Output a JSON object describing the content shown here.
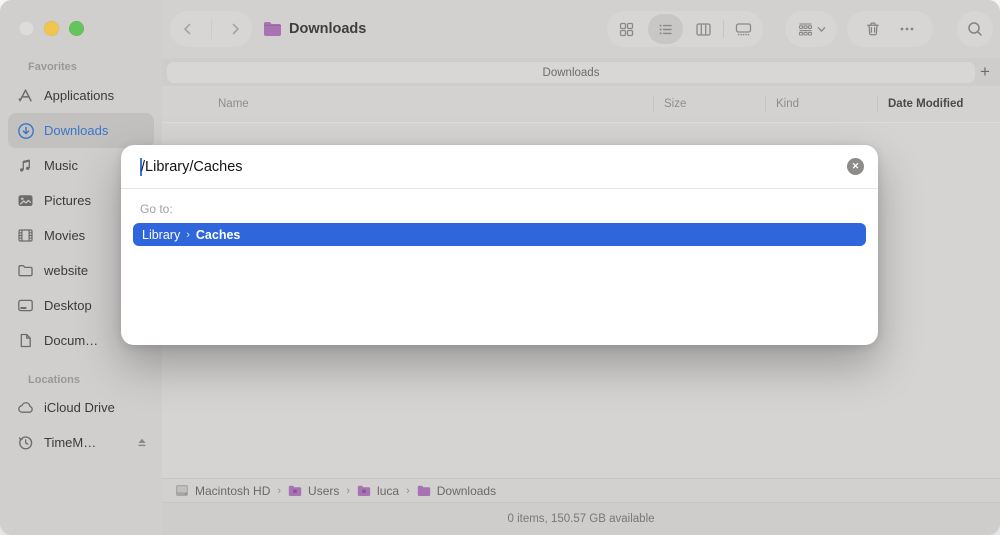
{
  "window": {
    "traffic_lights": [
      {
        "name": "close",
        "state": "disabled"
      },
      {
        "name": "minimize",
        "color": "#f0c64f"
      },
      {
        "name": "zoom",
        "color": "#65c45b"
      }
    ]
  },
  "toolbar": {
    "title": "Downloads",
    "title_icon": "folder-icon",
    "back_icon": "chevron-left-icon",
    "forward_icon": "chevron-right-icon",
    "view_modes": [
      {
        "name": "icon-view",
        "selected": false
      },
      {
        "name": "list-view",
        "selected": true
      },
      {
        "name": "column-view",
        "selected": false
      },
      {
        "name": "gallery-view",
        "selected": false
      }
    ],
    "group_button_icon": "group-by-icon",
    "trash_icon": "trash-icon",
    "more_icon": "ellipsis-icon",
    "search_icon": "search-icon"
  },
  "sidebar": {
    "sections": [
      {
        "title": "Favorites",
        "items": [
          {
            "label": "Applications",
            "icon": "applications-icon",
            "selected": false
          },
          {
            "label": "Downloads",
            "icon": "downloads-icon",
            "selected": true
          },
          {
            "label": "Music",
            "icon": "music-icon",
            "selected": false
          },
          {
            "label": "Pictures",
            "icon": "pictures-icon",
            "selected": false
          },
          {
            "label": "Movies",
            "icon": "movies-icon",
            "selected": false
          },
          {
            "label": "website",
            "icon": "folder-icon",
            "selected": false
          },
          {
            "label": "Desktop",
            "icon": "desktop-icon",
            "selected": false
          },
          {
            "label": "Docum…",
            "icon": "document-icon",
            "selected": false
          }
        ]
      },
      {
        "title": "Locations",
        "items": [
          {
            "label": "iCloud Drive",
            "icon": "cloud-icon",
            "selected": false
          },
          {
            "label": "TimeM…",
            "icon": "time-machine-icon",
            "trailing_icon": "eject-icon",
            "selected": false
          }
        ]
      }
    ]
  },
  "tab_bar": {
    "active_tab": "Downloads",
    "add_button": "+"
  },
  "list_header": {
    "columns": [
      {
        "label": "Name",
        "sorted": false
      },
      {
        "label": "Size",
        "sorted": false
      },
      {
        "label": "Kind",
        "sorted": false
      },
      {
        "label": "Date Modified",
        "sorted": true
      }
    ]
  },
  "path_bar": {
    "separator": "›",
    "items": [
      {
        "label": "Macintosh HD",
        "icon": "drive-icon"
      },
      {
        "label": "Users",
        "icon": "folder-icon"
      },
      {
        "label": "luca",
        "icon": "folder-icon"
      },
      {
        "label": "Downloads",
        "icon": "folder-icon"
      }
    ]
  },
  "status_bar": {
    "text": "0 items, 150.57 GB available"
  },
  "goto_dialog": {
    "input_value": "/Library/Caches",
    "clear_icon": "clear-circle-icon",
    "clear_glyph": "✕",
    "label": "Go to:",
    "suggestion": {
      "primary": "Library",
      "separator": "›",
      "secondary": "Caches"
    }
  },
  "colors": {
    "accent_blue": "#2f66db",
    "sidebar_selected_blue": "#3b76c9",
    "folder_purple": "#a873b2",
    "traffic_yellow": "#f0c64f",
    "traffic_green": "#65c45b"
  }
}
